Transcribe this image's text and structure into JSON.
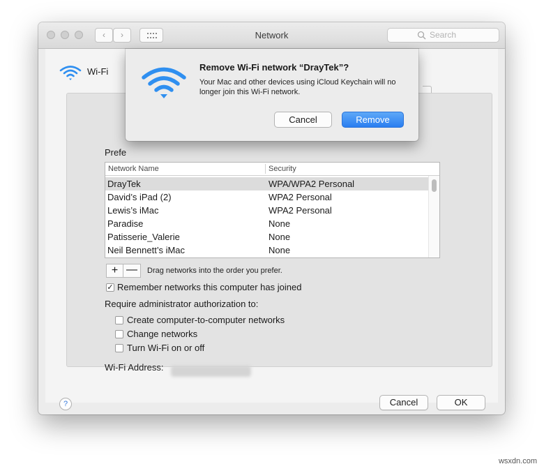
{
  "window": {
    "title": "Network",
    "search_placeholder": "Search",
    "back_glyph": "‹",
    "forward_glyph": "›"
  },
  "header": {
    "service_label": "Wi-Fi",
    "icon": "wifi-icon"
  },
  "preferred": {
    "label_visible": "Prefe",
    "columns": [
      "Network Name",
      "Security"
    ],
    "rows": [
      {
        "name": "DrayTek",
        "security": "WPA/WPA2 Personal",
        "selected": true
      },
      {
        "name": "David’s iPad (2)",
        "security": "WPA2 Personal",
        "selected": false
      },
      {
        "name": "Lewis’s iMac",
        "security": "WPA2 Personal",
        "selected": false
      },
      {
        "name": "Paradise",
        "security": "None",
        "selected": false
      },
      {
        "name": "Patisserie_Valerie",
        "security": "None",
        "selected": false
      },
      {
        "name": "Neil Bennett’s iMac",
        "security": "None",
        "selected": false
      }
    ],
    "add_glyph": "+",
    "remove_glyph": "—",
    "hint": "Drag networks into the order you prefer."
  },
  "options": {
    "remember": {
      "label": "Remember networks this computer has joined",
      "checked": true
    },
    "require_label": "Require administrator authorization to:",
    "admin_items": [
      {
        "label": "Create computer-to-computer networks",
        "checked": false
      },
      {
        "label": "Change networks",
        "checked": false
      },
      {
        "label": "Turn Wi-Fi on or off",
        "checked": false
      }
    ],
    "address_label": "Wi-Fi Address:"
  },
  "footer": {
    "help_glyph": "?",
    "cancel_label": "Cancel",
    "ok_label": "OK"
  },
  "sheet": {
    "title": "Remove Wi-Fi network “DrayTek”?",
    "body": "Your Mac and other devices using iCloud Keychain will no longer join this Wi-Fi network.",
    "cancel_label": "Cancel",
    "remove_label": "Remove",
    "accent": "#2a7ef0"
  },
  "watermark": "wsxdn.com",
  "colors": {
    "wifi_blue": "#2f8ff0",
    "selected_row": "#dcdcdc"
  }
}
